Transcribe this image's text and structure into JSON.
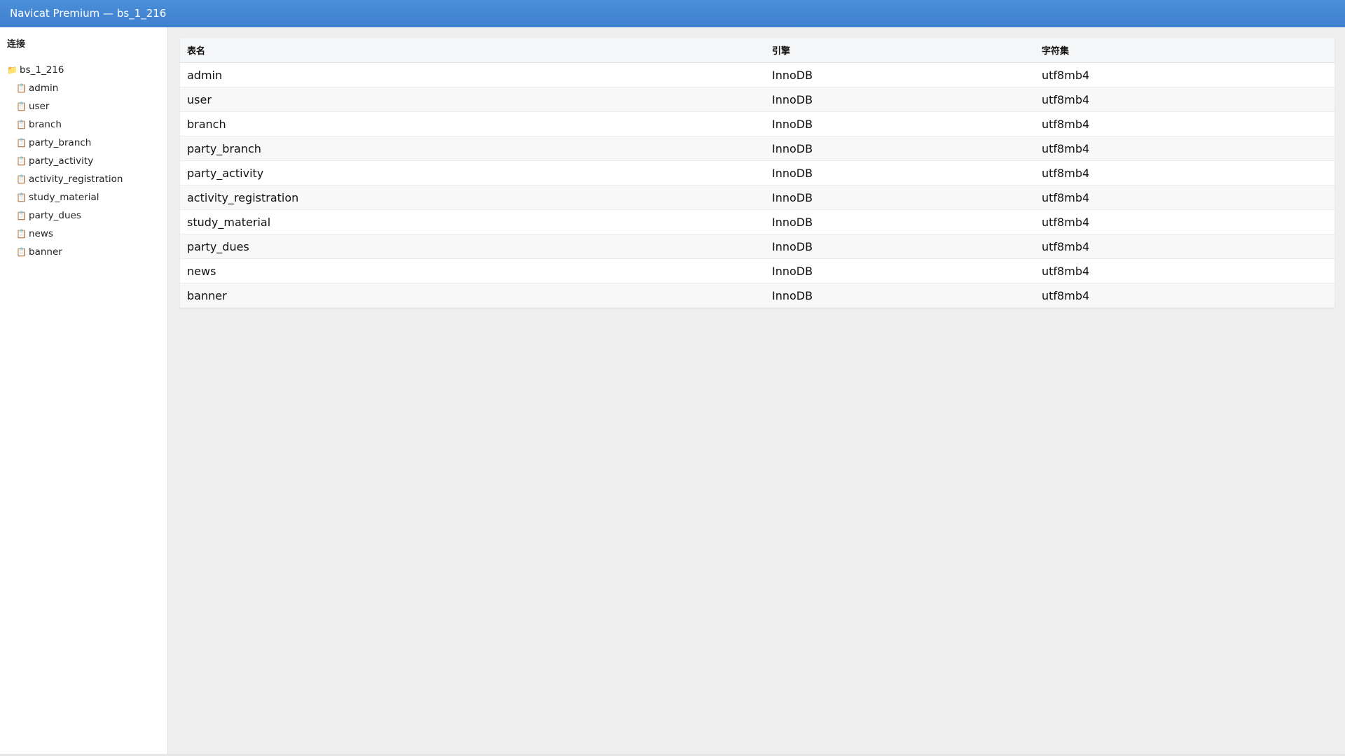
{
  "window": {
    "title": "Navicat Premium — bs_1_216"
  },
  "sidebar": {
    "heading": "连接",
    "database": {
      "name": "bs_1_216",
      "icon": "folder-icon"
    },
    "tables": [
      {
        "name": "admin",
        "icon": "table-icon"
      },
      {
        "name": "user",
        "icon": "table-icon"
      },
      {
        "name": "branch",
        "icon": "table-icon"
      },
      {
        "name": "party_branch",
        "icon": "table-icon"
      },
      {
        "name": "party_activity",
        "icon": "table-icon"
      },
      {
        "name": "activity_registration",
        "icon": "table-icon"
      },
      {
        "name": "study_material",
        "icon": "table-icon"
      },
      {
        "name": "party_dues",
        "icon": "table-icon"
      },
      {
        "name": "news",
        "icon": "table-icon"
      },
      {
        "name": "banner",
        "icon": "table-icon"
      }
    ]
  },
  "grid": {
    "columns": [
      "表名",
      "引擎",
      "字符集"
    ],
    "rows": [
      [
        "admin",
        "InnoDB",
        "utf8mb4"
      ],
      [
        "user",
        "InnoDB",
        "utf8mb4"
      ],
      [
        "branch",
        "InnoDB",
        "utf8mb4"
      ],
      [
        "party_branch",
        "InnoDB",
        "utf8mb4"
      ],
      [
        "party_activity",
        "InnoDB",
        "utf8mb4"
      ],
      [
        "activity_registration",
        "InnoDB",
        "utf8mb4"
      ],
      [
        "study_material",
        "InnoDB",
        "utf8mb4"
      ],
      [
        "party_dues",
        "InnoDB",
        "utf8mb4"
      ],
      [
        "news",
        "InnoDB",
        "utf8mb4"
      ],
      [
        "banner",
        "InnoDB",
        "utf8mb4"
      ]
    ]
  },
  "colors": {
    "titlebar": "#4a8ed8",
    "sidebar_bg": "#ffffff",
    "main_bg": "#efefef"
  }
}
